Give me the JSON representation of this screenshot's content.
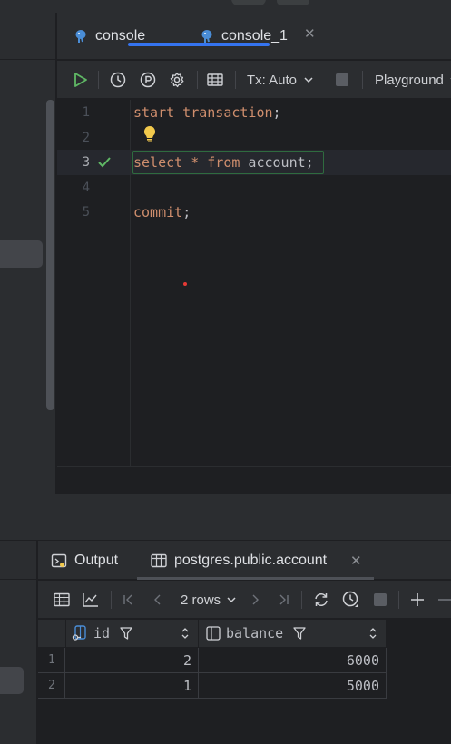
{
  "editor_tabs": [
    {
      "label": "console",
      "active": false
    },
    {
      "label": "console_1",
      "active": true
    }
  ],
  "toolbar": {
    "tx_mode": "Tx: Auto",
    "playground": "Playground"
  },
  "editor": {
    "line_numbers": [
      "1",
      "2",
      "3",
      "4",
      "5"
    ],
    "lines": [
      {
        "keyword1": "start transaction",
        "rest": ";"
      },
      {
        "text": ""
      },
      {
        "kw_select": "select",
        "star": " * ",
        "kw_from": "from",
        "ident": " account",
        "semi": ";"
      },
      {
        "text": ""
      },
      {
        "keyword1": "commit",
        "rest": ";"
      }
    ]
  },
  "results": {
    "tabs": [
      {
        "label": "Output"
      },
      {
        "label": "postgres.public.account",
        "active": true
      }
    ],
    "rows_label": "2 rows",
    "columns": [
      "id",
      "balance"
    ],
    "row_numbers": [
      "1",
      "2"
    ],
    "rows": [
      [
        "2",
        "6000"
      ],
      [
        "1",
        "5000"
      ]
    ]
  },
  "colors": {
    "accent": "#3574f0",
    "keyword": "#cf8e6d",
    "success": "#5fb865",
    "bulb": "#f2c94c"
  }
}
